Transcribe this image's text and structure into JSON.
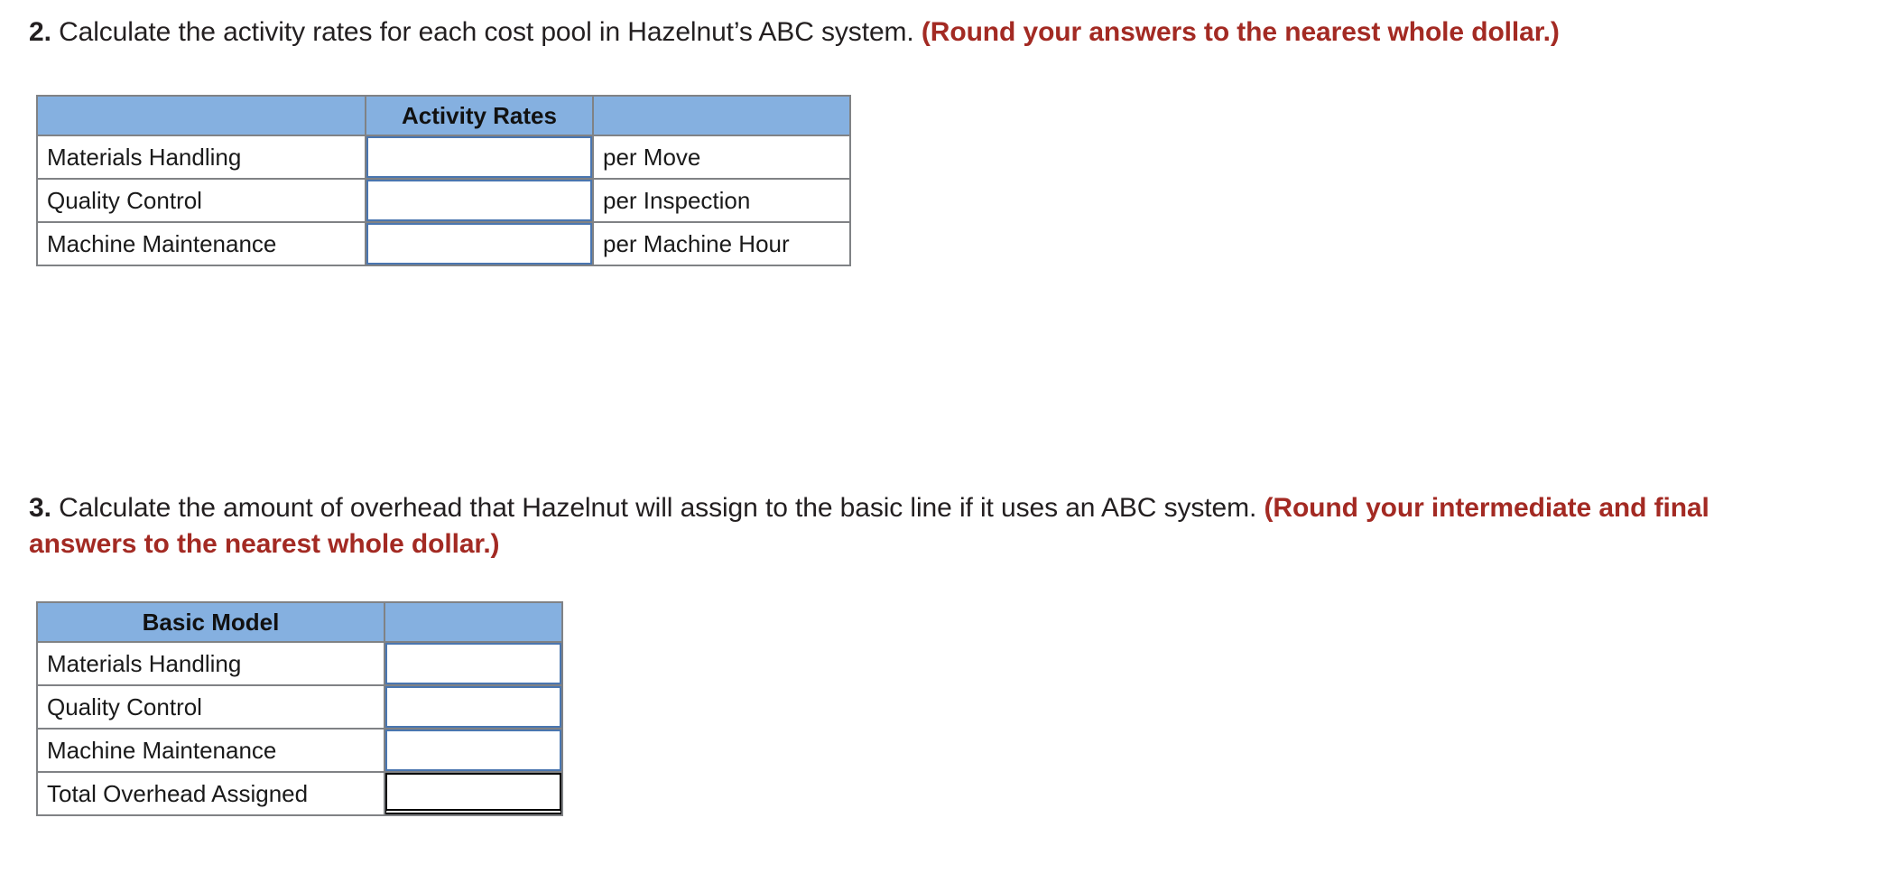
{
  "questions": [
    {
      "number": "2.",
      "body": " Calculate the activity rates for each cost pool in Hazelnut’s ABC system. ",
      "note": "(Round your answers to the nearest whole dollar.)"
    },
    {
      "number": "3.",
      "body": " Calculate the amount of overhead that Hazelnut will assign to the basic line if it uses an ABC system. ",
      "note": "(Round your intermediate and final answers to the nearest whole dollar.)"
    }
  ],
  "activity_rates_table": {
    "headers": [
      "",
      "Activity Rates",
      ""
    ],
    "rows": [
      {
        "label": "Materials Handling",
        "value": "",
        "unit": "per Move"
      },
      {
        "label": "Quality Control",
        "value": "",
        "unit": "per Inspection"
      },
      {
        "label": "Machine Maintenance",
        "value": "",
        "unit": "per Machine Hour"
      }
    ]
  },
  "basic_model_table": {
    "headers": [
      "Basic Model",
      ""
    ],
    "rows": [
      {
        "label": "Materials Handling",
        "value": "",
        "total": false
      },
      {
        "label": "Quality Control",
        "value": "",
        "total": false
      },
      {
        "label": "Machine Maintenance",
        "value": "",
        "total": false
      },
      {
        "label": "Total Overhead Assigned",
        "value": "",
        "total": true
      }
    ]
  },
  "colors": {
    "header_fill": "#85b0e0",
    "entry_border": "#4a76b0",
    "grid_line": "#808285",
    "note_text": "#a32a23",
    "total_rule": "#000000"
  }
}
